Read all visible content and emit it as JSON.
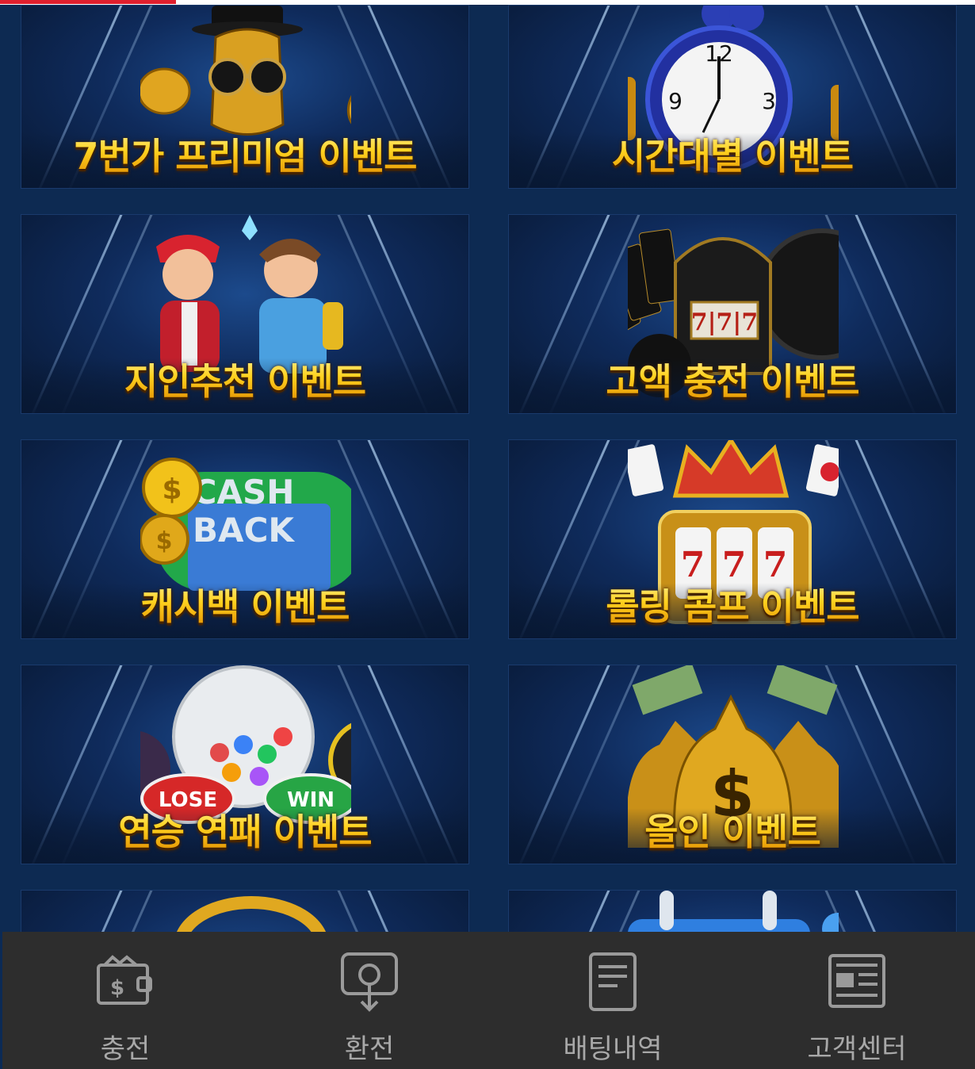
{
  "events": [
    {
      "title": "7번가 프리미엄 이벤트",
      "art": "gold-dollar-mascot"
    },
    {
      "title": "시간대별 이벤트",
      "art": "alarm-clock-coins"
    },
    {
      "title": "지인추천 이벤트",
      "art": "two-cartoon-boys"
    },
    {
      "title": "고액 충전 이벤트",
      "art": "slot-machine-cards"
    },
    {
      "title": "캐시백 이벤트",
      "art": "cashback-coins"
    },
    {
      "title": "롤링 콤프 이벤트",
      "art": "crown-slot-777"
    },
    {
      "title": "연승 연패 이벤트",
      "art": "lottery-lose-win"
    },
    {
      "title": "올인 이벤트",
      "art": "gold-money-bags"
    },
    {
      "title": "",
      "art": "gold-ring-partial"
    },
    {
      "title": "",
      "art": "calendar-partial"
    }
  ],
  "nav": {
    "items": [
      {
        "label": "충전",
        "icon": "wallet-dollar-icon"
      },
      {
        "label": "환전",
        "icon": "withdraw-icon"
      },
      {
        "label": "배팅내역",
        "icon": "document-icon"
      },
      {
        "label": "고객센터",
        "icon": "newspaper-icon"
      }
    ]
  },
  "colors": {
    "accent": "#e0202e",
    "background": "#0d2a52",
    "title_gold": "#ffc21a",
    "nav_bg": "#2d2d2d",
    "nav_text": "#a8a8a8"
  }
}
